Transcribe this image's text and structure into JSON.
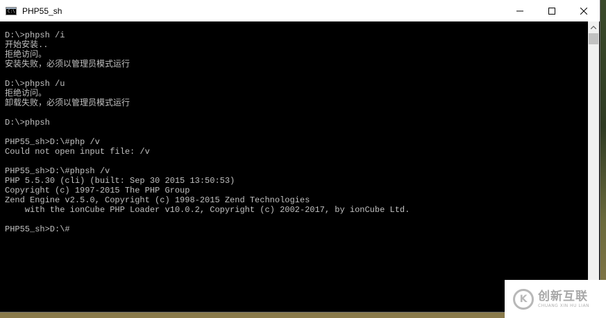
{
  "window": {
    "title": "PHP55_sh",
    "icon": "console-icon",
    "icon_glyph": "C:\\"
  },
  "controls": {
    "minimize": "minimize-icon",
    "maximize": "maximize-icon",
    "close": "close-icon"
  },
  "console": {
    "lines": [
      "D:\\>phpsh /i",
      "开始安装..",
      "拒绝访问。",
      "安装失败，必须以管理员模式运行",
      "",
      "D:\\>phpsh /u",
      "拒绝访问。",
      "卸载失败，必须以管理员模式运行",
      "",
      "D:\\>phpsh",
      "",
      "PHP55_sh>D:\\#php /v",
      "Could not open input file: /v",
      "",
      "PHP55_sh>D:\\#phpsh /v",
      "PHP 5.5.30 (cli) (built: Sep 30 2015 13:50:53)",
      "Copyright (c) 1997-2015 The PHP Group",
      "Zend Engine v2.5.0, Copyright (c) 1998-2015 Zend Technologies",
      "    with the ionCube PHP Loader v10.0.2, Copyright (c) 2002-2017, by ionCube Ltd.",
      "",
      "PHP55_sh>D:\\#"
    ],
    "text_color": "#c0c0c0",
    "background": "#000000"
  },
  "watermark": {
    "brand_cn": "创新互联",
    "brand_en": "CHUANG XIN HU LIAN",
    "logo_glyph": "K"
  }
}
